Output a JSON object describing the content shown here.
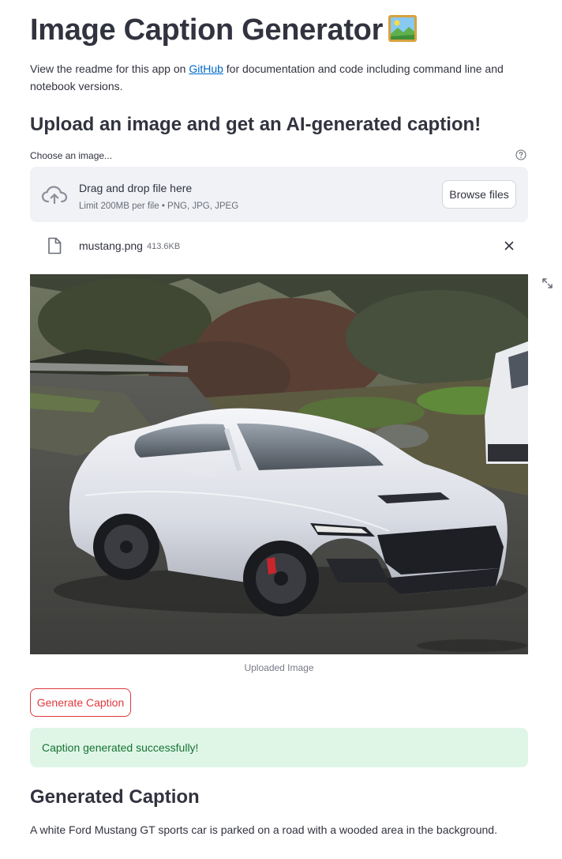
{
  "header": {
    "title": "Image Caption Generator",
    "title_emoji": "framed-picture-icon"
  },
  "intro": {
    "before_link": "View the readme for this app on ",
    "link_text": "GitHub",
    "after_link": " for documentation and code including command line and notebook versions."
  },
  "subtitle": "Upload an image and get an AI-generated caption!",
  "uploader": {
    "label": "Choose an image...",
    "drop_text": "Drag and drop file here",
    "limit_text": "Limit 200MB per file • PNG, JPG, JPEG",
    "browse_label": "Browse files",
    "help_icon": "question-circle-icon",
    "upload_icon": "cloud-upload-icon"
  },
  "uploaded_file": {
    "name": "mustang.png",
    "size": "413.6KB",
    "file_icon": "file-icon",
    "remove_icon": "close-icon"
  },
  "image": {
    "caption": "Uploaded Image",
    "fullscreen_icon": "fullscreen-icon"
  },
  "actions": {
    "generate_label": "Generate Caption"
  },
  "status": {
    "success_text": "Caption generated successfully!"
  },
  "result": {
    "heading": "Generated Caption",
    "text": "A white Ford Mustang GT sports car is parked on a road with a wooded area in the background."
  },
  "colors": {
    "primary": "#e0393e",
    "link": "#0068c9",
    "success_bg": "#dff6e7",
    "success_text": "#177233",
    "text": "#31333f",
    "dropzone_bg": "#f0f2f6"
  }
}
